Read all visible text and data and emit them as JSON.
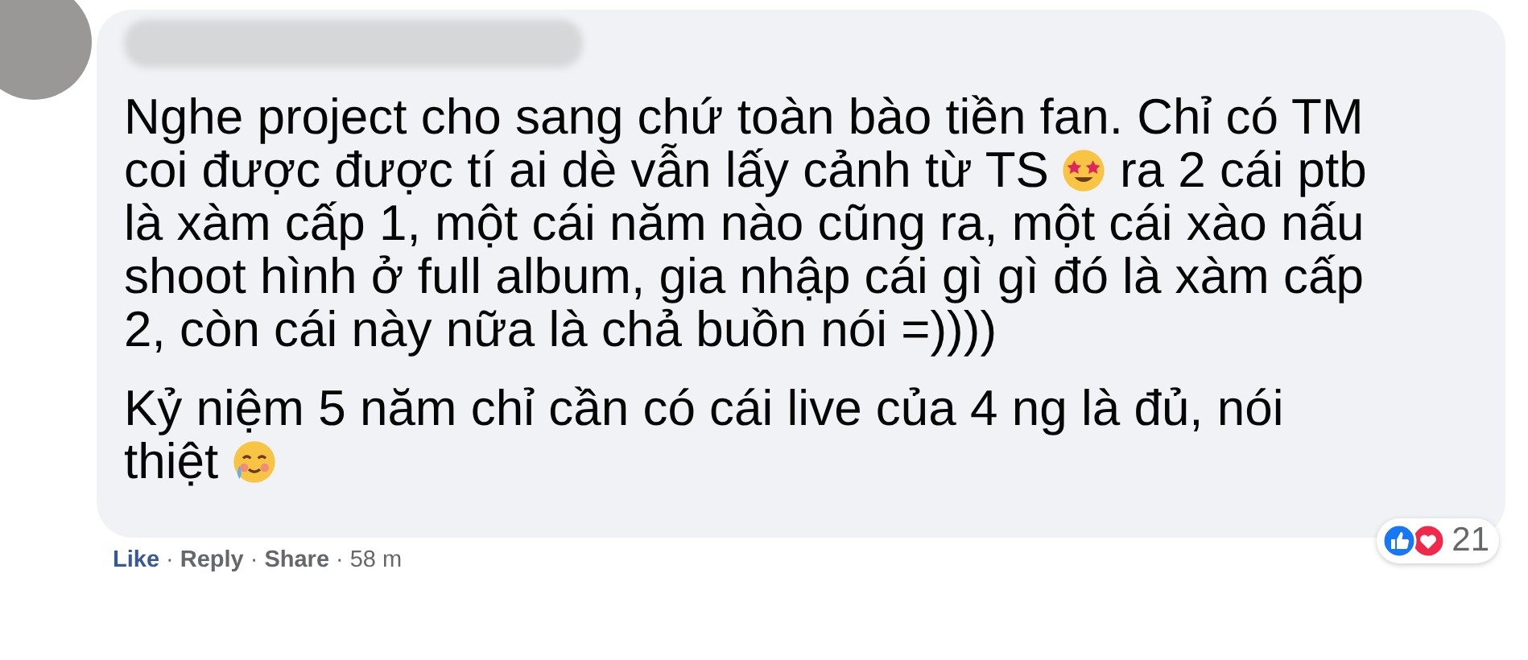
{
  "comment": {
    "author": {
      "redacted": true
    },
    "paragraphs": [
      [
        [
          {
            "kind": "text",
            "text": "Nghe project cho sang chứ toàn bào tiền fan. Chỉ có TM"
          }
        ],
        [
          {
            "kind": "text",
            "text": "coi được được tí ai dè vẫn lấy cảnh từ TS"
          },
          {
            "kind": "starstruck"
          },
          {
            "kind": "text",
            "text": "ra 2 cái ptb"
          }
        ],
        [
          {
            "kind": "text",
            "text": "là xàm cấp 1, một cái năm nào cũng ra, một cái xào nấu"
          }
        ],
        [
          {
            "kind": "text",
            "text": "shoot hình ở full album, gia nhập cái gì gì đó là xàm cấp"
          }
        ],
        [
          {
            "kind": "text",
            "text": "2, còn cái này nữa là chả buồn nói =))))"
          }
        ]
      ],
      [
        [
          {
            "kind": "text",
            "text": "Kỷ niệm 5 năm chỉ cần có cái live của 4 ng là đủ, nói"
          }
        ],
        [
          {
            "kind": "text",
            "text": "thiệt"
          },
          {
            "kind": "teary"
          }
        ]
      ]
    ],
    "reactions": {
      "count": "21"
    },
    "footer": [
      {
        "kind": "action",
        "label": "Like",
        "active": true
      },
      {
        "kind": "separator",
        "label": "·"
      },
      {
        "kind": "action",
        "label": "Reply",
        "active": false
      },
      {
        "kind": "separator",
        "label": "·"
      },
      {
        "kind": "action",
        "label": "Share",
        "active": false
      },
      {
        "kind": "separator",
        "label": "·"
      },
      {
        "kind": "time",
        "label": "58 m"
      }
    ]
  }
}
